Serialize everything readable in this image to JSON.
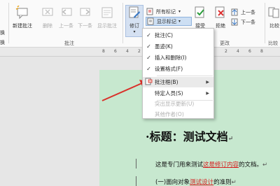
{
  "ribbon": {
    "edge_left": {
      "label_top": "换",
      "label_bottom": "换"
    },
    "comments_group": {
      "label": "批注",
      "new_comment": "新建批注",
      "delete": "删除",
      "previous": "上一条",
      "next": "下一条",
      "show_comments": "显示批注"
    },
    "tracking_group": {
      "track_changes": "修订",
      "markup_select": "所有标记",
      "show_markup": "显示标记"
    },
    "changes_group": {
      "label": "更改",
      "accept": "接受",
      "reject": "拒绝",
      "previous": "上一条",
      "next": "下一条"
    },
    "compare_group": {
      "compare": "比较",
      "label": "比较"
    }
  },
  "ruler": {
    "ticks": [
      "8",
      "6",
      "4",
      "2",
      "2",
      "4",
      "6",
      "8"
    ]
  },
  "show_markup_menu": {
    "items": [
      {
        "label": "批注(C)",
        "checked": true,
        "enabled": true,
        "submenu": false
      },
      {
        "label": "墨迹(K)",
        "checked": true,
        "enabled": true,
        "submenu": false
      },
      {
        "label": "插入和删除(I)",
        "checked": true,
        "enabled": true,
        "submenu": false
      },
      {
        "label": "设置格式(F)",
        "checked": true,
        "enabled": true,
        "submenu": false
      },
      {
        "label": "批注框(B)",
        "checked": false,
        "enabled": true,
        "submenu": true
      },
      {
        "label": "特定人员(S)",
        "checked": false,
        "enabled": true,
        "submenu": true
      },
      {
        "label": "突出显示更新(U)",
        "checked": false,
        "enabled": false,
        "submenu": false
      },
      {
        "label": "其他作者(O)",
        "checked": false,
        "enabled": false,
        "submenu": false
      }
    ],
    "check_glyph": "✓",
    "submenu_glyph": "▶"
  },
  "document": {
    "title": "·标题：测试文档",
    "paragraph1_prefix": "这是专门用来测试",
    "paragraph1_revision": "这是修订内容",
    "paragraph1_suffix": "的文档。",
    "paragraph2_prefix": "(一)面向对象",
    "paragraph2_revision": "测试设计",
    "paragraph2_suffix": "的准则",
    "para_mark": "↵"
  },
  "colors": {
    "arrow": "#d9302a",
    "page_background": "#c7e8cf",
    "revision_text": "#d62020"
  }
}
